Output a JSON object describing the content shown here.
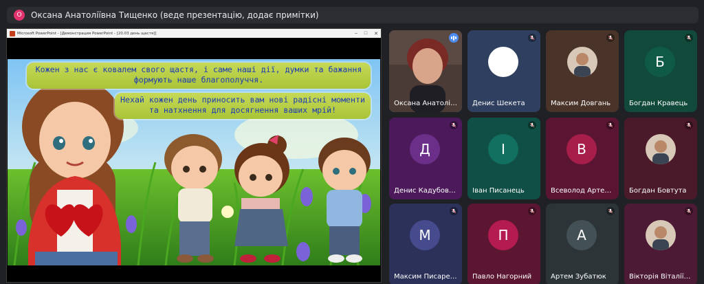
{
  "banner": {
    "initial": "О",
    "initial_color": "#e3336f",
    "text": "Оксана Анатоліївна Тищенко (веде презентацію, додає примітки)"
  },
  "ppt_window": {
    "title": "Microsoft PowerPoint - [Демонстрация PowerPoint - [20.03 день щастя]]",
    "controls": [
      "–",
      "□",
      "✕"
    ],
    "slide_text_1": "Кожен з нас є ковалем свого щастя, і саме наші дії, думки та бажання формують наше благополуччя.",
    "slide_text_2": "Нехай кожен день приносить вам нові радісні моменти та натхнення для досягнення ваших мрій!"
  },
  "colors": {
    "mic_muted": "#ffffff",
    "speaking": "#4b8cf0"
  },
  "participants": [
    {
      "name": "Оксана Анатоліїв...",
      "type": "video",
      "bg": "#3a3130",
      "status": "speaking",
      "active": true
    },
    {
      "name": "Денис Шекета",
      "type": "blank",
      "bg": "#2f3f5f",
      "status": "muted"
    },
    {
      "name": "Максим Довгань",
      "type": "photo",
      "bg": "#4a3328",
      "status": "muted"
    },
    {
      "name": "Богдан Кравець",
      "type": "initial",
      "initial": "Б",
      "bg": "#114a3b",
      "circle": "#0f5a46",
      "status": "muted"
    },
    {
      "name": "Денис Кадубовс...",
      "type": "initial",
      "initial": "Д",
      "bg": "#4c1a5a",
      "circle": "#6b2f8a",
      "status": "muted"
    },
    {
      "name": "Іван Писанець",
      "type": "initial",
      "initial": "І",
      "bg": "#0f4f45",
      "circle": "#127060",
      "status": "muted"
    },
    {
      "name": "Всеволод Артем...",
      "type": "initial",
      "initial": "В",
      "bg": "#5a1532",
      "circle": "#a81e4b",
      "status": "muted"
    },
    {
      "name": "Богдан Бовтута",
      "type": "photo",
      "bg": "#4a1a2a",
      "status": "muted"
    },
    {
      "name": "Максим Писарен...",
      "type": "initial",
      "initial": "М",
      "bg": "#2c315a",
      "circle": "#454b8c",
      "status": "muted"
    },
    {
      "name": "Павло Нагорний",
      "type": "initial",
      "initial": "П",
      "bg": "#5b1632",
      "circle": "#b31b51",
      "status": "muted"
    },
    {
      "name": "Артем Зубатюк",
      "type": "initial",
      "initial": "А",
      "bg": "#2c3437",
      "circle": "#435055",
      "status": "muted"
    },
    {
      "name": "Вікторія Віталіїв...",
      "type": "photo",
      "bg": "#4d1a35",
      "status": "muted"
    }
  ]
}
